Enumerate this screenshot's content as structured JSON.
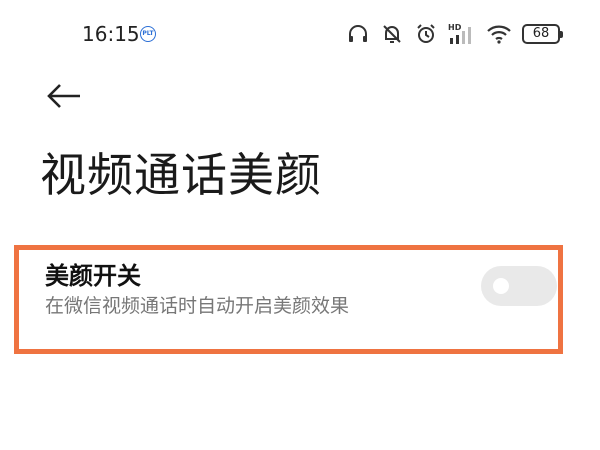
{
  "status_bar": {
    "time": "16:15",
    "badge": "PLT",
    "battery": "68",
    "signal_label": "HD"
  },
  "header": {
    "back_icon": "arrow-left-icon",
    "title": "视频通话美颜"
  },
  "setting": {
    "title": "美颜开关",
    "description": "在微信视频通话时自动开启美颜效果",
    "toggle_state": "off"
  },
  "colors": {
    "highlight": "#ef7341",
    "toggle_off": "#e9e9e9",
    "badge_blue": "#2b6fd6"
  }
}
